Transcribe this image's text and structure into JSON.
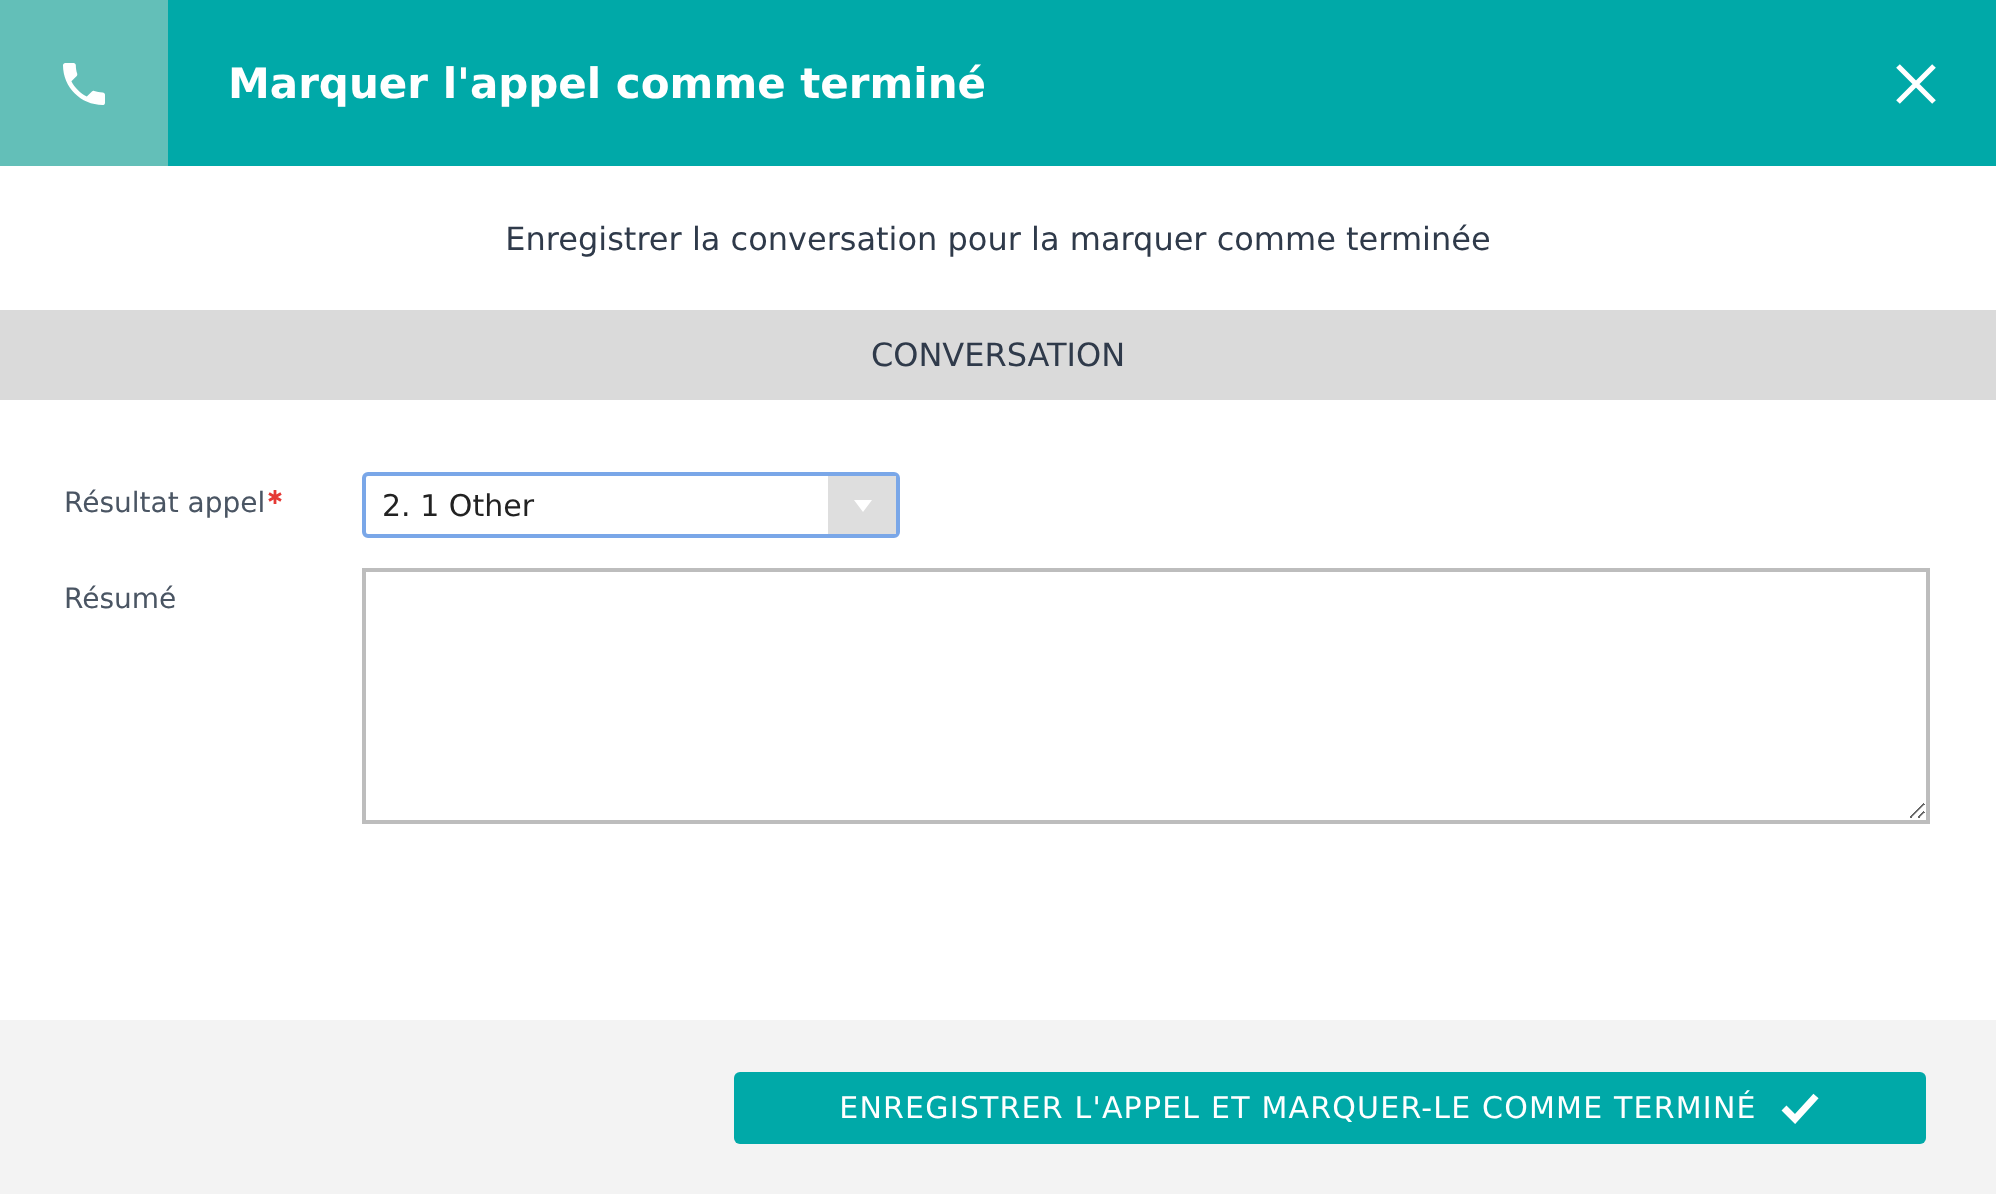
{
  "dialog": {
    "title": "Marquer l'appel comme terminé",
    "subtitle": "Enregistrer la conversation pour la marquer comme terminée",
    "section": "CONVERSATION",
    "fields": [
      {
        "kind": "select",
        "label": "Résultat appel",
        "required": true,
        "value": "2. 1 Other"
      },
      {
        "kind": "textarea",
        "label": "Résumé",
        "required": false
      }
    ],
    "submit": "ENREGISTRER L'APPEL ET MARQUER-LE COMME TERMINÉ"
  }
}
